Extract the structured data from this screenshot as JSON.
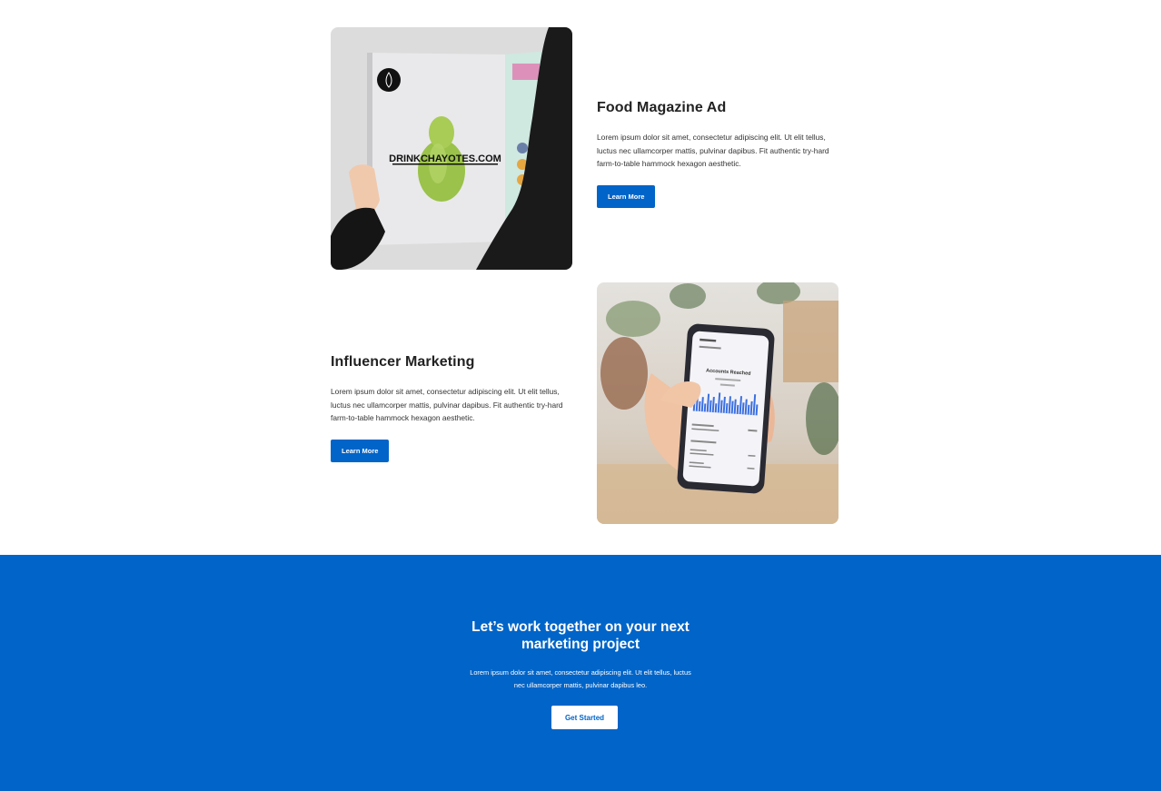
{
  "projects": [
    {
      "title": "Food Magazine Ad",
      "description": "Lorem ipsum dolor sit amet, consectetur adipiscing elit. Ut elit tellus, luctus nec ullamcorper mattis, pulvinar dapibus. Fit authentic try-hard farm-to-table hammock hexagon aesthetic.",
      "button": "Learn More",
      "image_text": "DRINKCHAYOTES.COM"
    },
    {
      "title": "Influencer Marketing",
      "description": "Lorem ipsum dolor sit amet, consectetur adipiscing elit. Ut elit tellus, luctus nec ullamcorper mattis, pulvinar dapibus. Fit authentic try-hard farm-to-table hammock hexagon aesthetic.",
      "button": "Learn More",
      "phone_text": "Accounts Reached"
    }
  ],
  "cta": {
    "title_line1": "Let’s work together on your next",
    "title_line2": "marketing project",
    "text_line1": "Lorem ipsum dolor sit amet, consectetur adipiscing elit. Ut elit tellus, luctus",
    "text_line2": "nec ullamcorper mattis, pulvinar dapibus leo.",
    "button": "Get Started"
  },
  "colors": {
    "brand_blue": "#0064c8",
    "background": "#ffffff"
  }
}
